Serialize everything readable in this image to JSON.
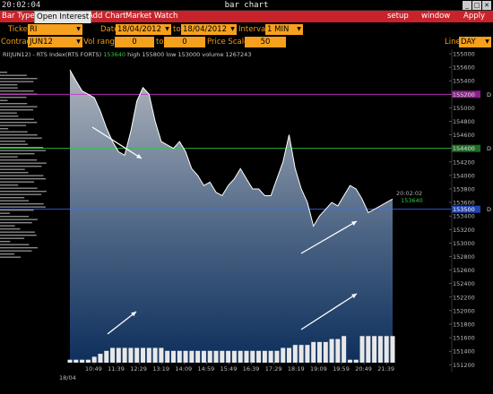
{
  "titlebar": {
    "clock": "20:02:04",
    "title": "bar chart",
    "buttons": [
      "_",
      "□",
      "✕"
    ]
  },
  "menu": {
    "bar_type": "Bar Type",
    "open_interest": "Open Interest",
    "add_chart": "Add Chart",
    "market_watch": "Market Watch",
    "setup": "setup",
    "window": "window",
    "apply": "Apply"
  },
  "controls": {
    "ticker_label": "Ticker",
    "ticker_value": "RI",
    "date_label": "Date",
    "date_from": "18/04/2012",
    "to_label": "to",
    "date_to": "18/04/2012",
    "interval_label": "Interval",
    "interval_value": "1 MIN",
    "contract_label": "Contract",
    "contract_value": "JUN12",
    "vol_range_label": "Vol range",
    "vol_from": "0",
    "vol_to_label": "to",
    "vol_to": "0",
    "price_scale_label": "Price Scale",
    "price_scale_value": "50",
    "line_label": "Line",
    "line_value": "DAY"
  },
  "info": {
    "symbol": "RI(JUN12) - RTS Index(RTS FORTS)",
    "last": "153640",
    "high": "high 155800",
    "low": "low 153000",
    "volume": "volume 1267243"
  },
  "colors": {
    "accent": "#f6a11d",
    "menu": "#c8232b",
    "hline_magenta": "#cc33cc",
    "hline_green": "#2ecc40",
    "hline_blue": "#3a6cff",
    "price_green": "#2ecc40"
  },
  "chart_data": {
    "type": "line",
    "y_ticks": [
      "155000",
      "155600",
      "155400",
      "155200",
      "155000",
      "154800",
      "154600",
      "154400",
      "154200",
      "154000",
      "153800",
      "153600",
      "153400",
      "153200",
      "153000",
      "152800",
      "152600",
      "152400",
      "152200",
      "152000",
      "151800",
      "151600",
      "151400",
      "151200"
    ],
    "x_ticks": [
      "10:49",
      "11:39",
      "12:29",
      "13:19",
      "14:09",
      "14:59",
      "15:49",
      "16:39",
      "17:29",
      "18:19",
      "19:09",
      "19:59",
      "20:49",
      "21:39"
    ],
    "date_label": "18/04",
    "hlines": [
      {
        "value": "155200",
        "tag": "D",
        "color": "magenta"
      },
      {
        "value": "154400",
        "tag": "D",
        "color": "green"
      },
      {
        "value": "153500",
        "tag": "D",
        "color": "blue"
      }
    ],
    "last_time": "20:02:02",
    "last_value": "153640",
    "price": [
      155560,
      155400,
      155250,
      155200,
      155150,
      154950,
      154700,
      154500,
      154350,
      154300,
      154650,
      155100,
      155300,
      155200,
      154800,
      154500,
      154450,
      154400,
      154500,
      154350,
      154100,
      154000,
      153850,
      153900,
      153750,
      153700,
      153850,
      153950,
      154100,
      153950,
      153800,
      153800,
      153700,
      153700,
      153950,
      154200,
      154600,
      154100,
      153800,
      153600,
      153250,
      153400,
      153500,
      153600,
      153550,
      153700,
      153850,
      153800,
      153650,
      153450,
      153500,
      153550,
      153600,
      153650
    ],
    "volume": [
      1,
      1,
      1,
      1,
      2,
      3,
      4,
      5,
      5,
      5,
      5,
      5,
      5,
      5,
      5,
      5,
      4,
      4,
      4,
      4,
      4,
      4,
      4,
      4,
      4,
      4,
      4,
      4,
      4,
      4,
      4,
      4,
      4,
      4,
      4,
      5,
      5,
      6,
      6,
      6,
      7,
      7,
      7,
      8,
      8,
      9,
      1,
      1,
      9,
      9,
      9,
      9,
      9,
      9
    ]
  }
}
